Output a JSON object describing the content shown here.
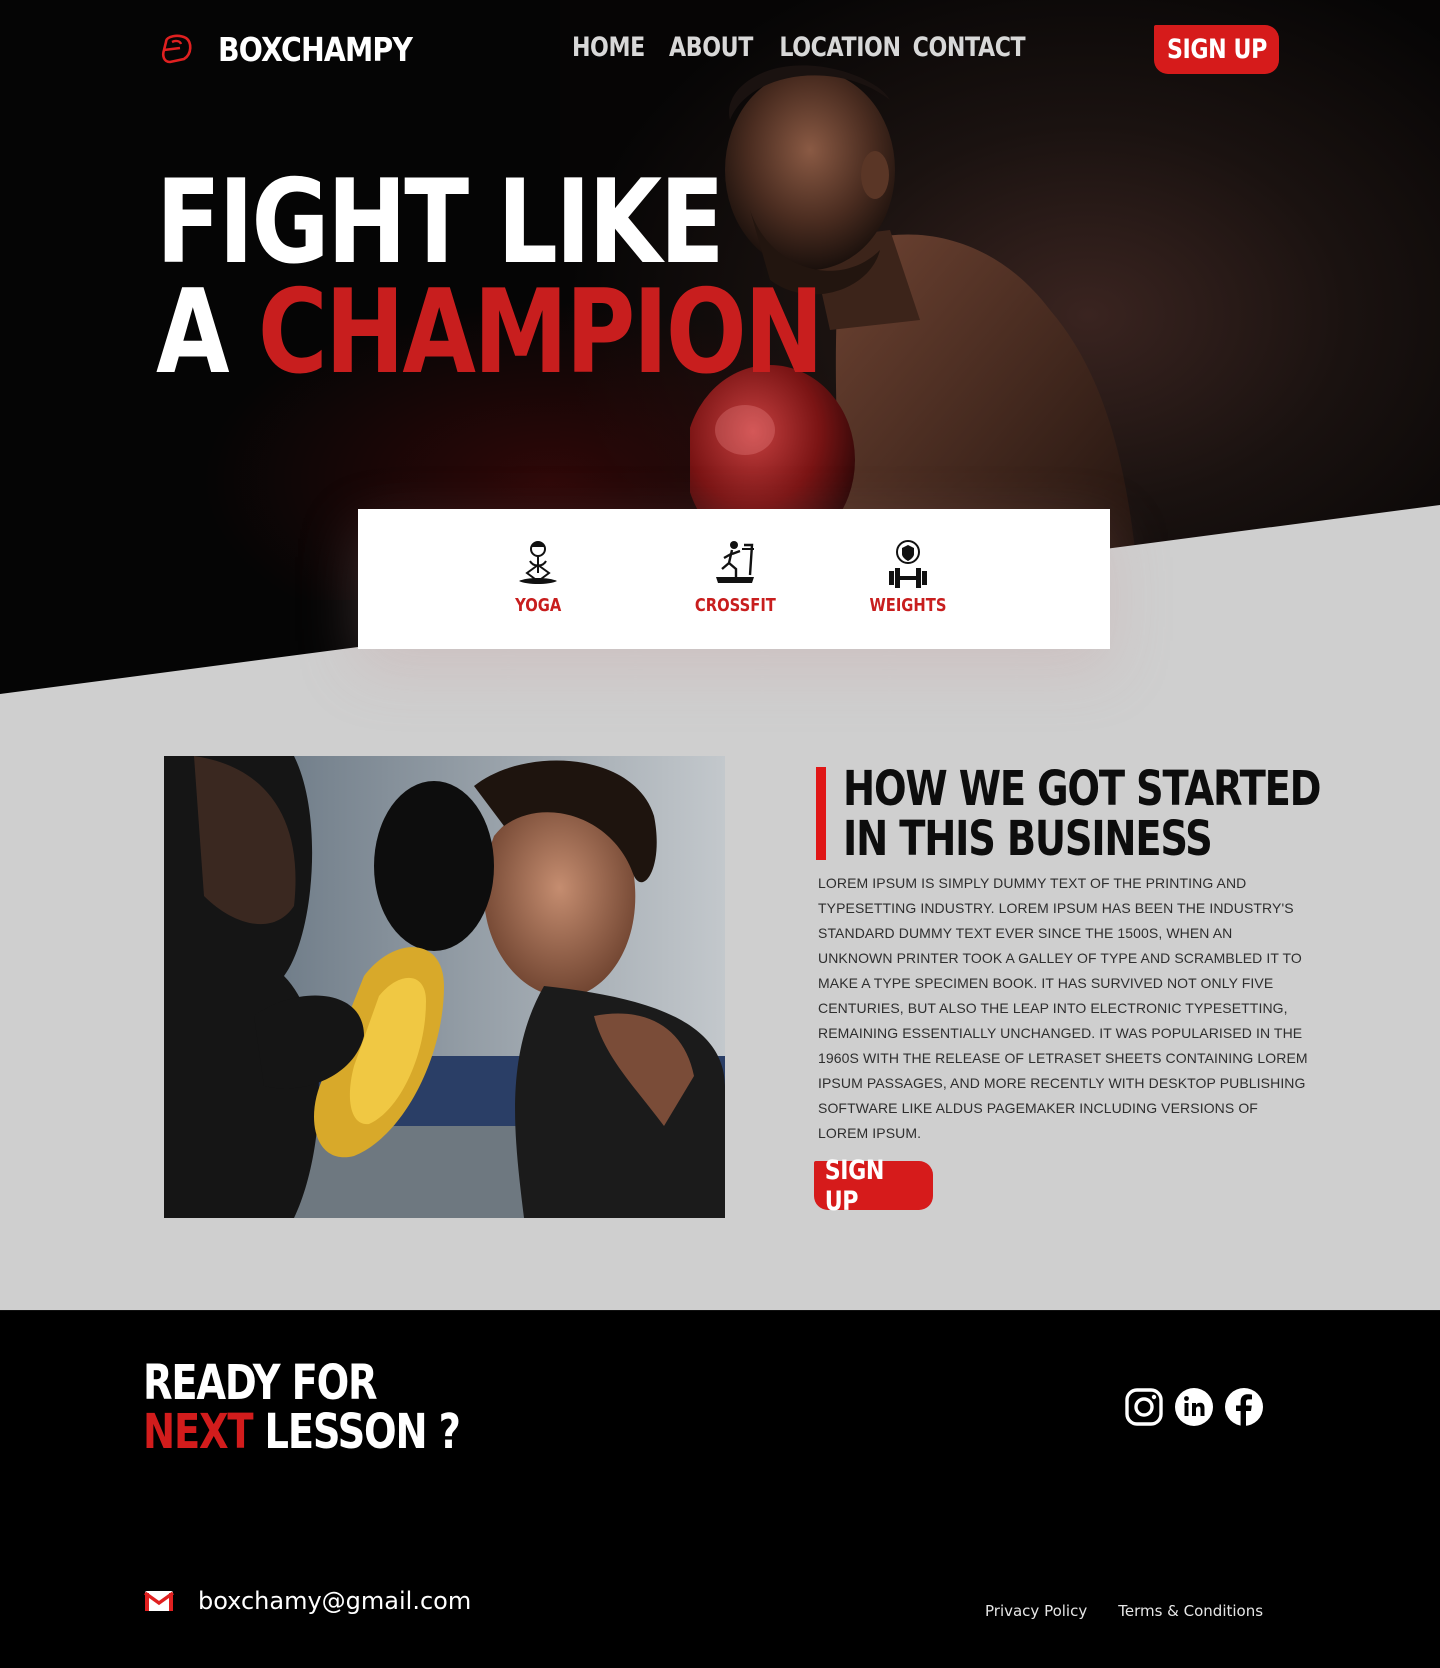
{
  "brand": {
    "name": "BOXCHAMPY",
    "logo_icon": "boxing-glove-icon"
  },
  "nav": {
    "items": [
      "HOME",
      "ABOUT",
      "LOCATION",
      "CONTACT"
    ],
    "signup_label": "SIGN UP"
  },
  "hero": {
    "line1": "FIGHT LIKE",
    "line2_white": "A",
    "line2_red": "CHAMPION"
  },
  "services": [
    {
      "label": "YOGA",
      "icon": "yoga-icon"
    },
    {
      "label": "CROSSFIT",
      "icon": "treadmill-icon"
    },
    {
      "label": "WEIGHTS",
      "icon": "dumbbell-icon"
    }
  ],
  "about": {
    "title_line1": "HOW WE GOT STARTED",
    "title_line2": "IN THIS BUSINESS",
    "body": "Lorem Ipsum is simply dummy text of the printing and typesetting industry. Lorem Ipsum has been the industry's standard dummy text ever since the 1500s, when an unknown printer took a galley of type and scrambled it to make a type specimen book. It has survived not only five centuries, but also the leap into electronic typesetting, remaining essentially unchanged. It was popularised in the 1960s with the release of Letraset sheets containing Lorem Ipsum passages, and more recently with desktop publishing software like Aldus PageMaker including versions of Lorem Ipsum.",
    "signup_label": "SIGN UP"
  },
  "footer": {
    "ready_line1": "READY FOR",
    "ready_red": "NEXT",
    "ready_rest": "LESSON ?",
    "socials": [
      "instagram-icon",
      "linkedin-icon",
      "facebook-icon"
    ],
    "email": "boxchamy@gmail.com",
    "links": [
      "Privacy Policy",
      "Terms & Conditions"
    ]
  },
  "colors": {
    "accent": "#d61b1b",
    "hero_bg": "#050505",
    "section_bg": "#cfcfcf",
    "footer_bg": "#000000"
  }
}
